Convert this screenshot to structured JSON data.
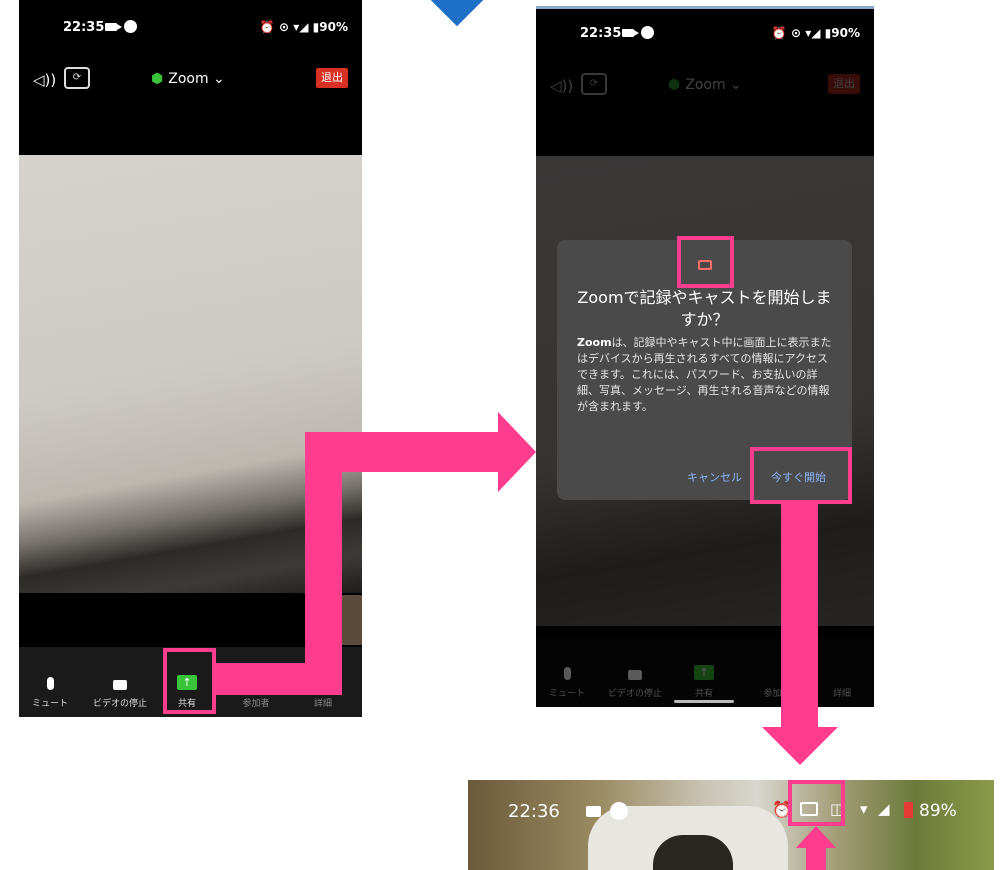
{
  "phone1": {
    "status": {
      "time": "22:35",
      "icons": "⏰ ⊙ ▾◢ ▮90%"
    },
    "topbar": {
      "meeting_title": "Zoom ⌄",
      "leave_label": "退出"
    },
    "toolbar": {
      "mute_label": "ミュート",
      "video_label": "ビデオの停止",
      "share_label": "共有",
      "participants_label": "参加者",
      "details_label": "詳細"
    }
  },
  "phone2": {
    "status": {
      "time": "22:35",
      "icons": "⏰ ⊙ ▾◢ ▮90%"
    },
    "topbar": {
      "meeting_title": "Zoom ⌄",
      "leave_label": "退出"
    },
    "dialog": {
      "title": "Zoomで記録やキャストを開始しますか？",
      "body_app": "Zoom",
      "body_text": "は、記録中やキャスト中に画面上に表示またはデバイスから再生されるすべての情報にアクセスできます。これには、パスワード、お支払いの詳細、写真、メッセージ、再生される音声などの情報が含まれます。",
      "cancel_label": "キャンセル",
      "start_label": "今すぐ開始"
    },
    "toolbar": {
      "mute_label": "ミュート",
      "video_label": "ビデオの停止",
      "share_label": "共有",
      "participants_label": "参加者",
      "details_label": "詳細"
    }
  },
  "phone3": {
    "status": {
      "time": "22:36",
      "battery": "89%"
    }
  },
  "colors": {
    "highlight": "#ff3c8d",
    "zoom_green": "#3ac43a",
    "leave_red": "#d93025",
    "dialog_link": "#8ab4f8"
  }
}
